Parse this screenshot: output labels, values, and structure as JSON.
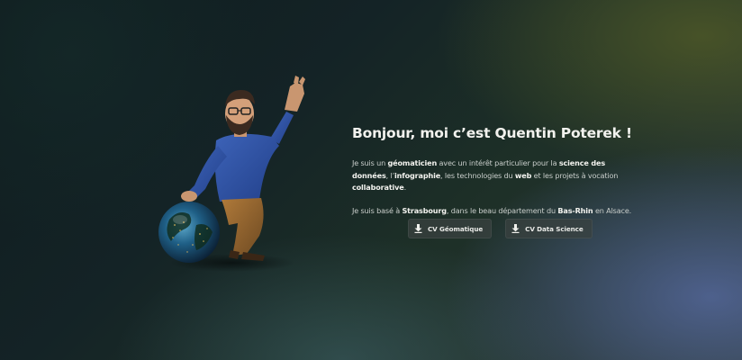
{
  "intro": {
    "headline": "Bonjour, moi c’est Quentin Poterek !",
    "p1": {
      "t1": "Je suis un ",
      "b1": "géomaticien",
      "t2": " avec un intérêt particulier pour la ",
      "b2": "science des données",
      "t3": ", l’",
      "b3": "infographie",
      "t4": ", les technologies du ",
      "b4": "web",
      "t5": " et les projets à vocation ",
      "b5": "collaborative",
      "t6": "."
    },
    "p2": {
      "t1": "Je suis basé à ",
      "b1": "Strasbourg",
      "t2": ", dans le beau département du ",
      "b2": "Bas-Rhin",
      "t3": " en Alsace."
    }
  },
  "buttons": {
    "cv_geomatique": "CV Géomatique",
    "cv_data_science": "CV Data Science"
  },
  "icons": {
    "download": "download-arrow-icon"
  },
  "colors": {
    "headline": "#f2f2ee",
    "body_text": "#c9cecb",
    "button_bg": "#3a4240"
  }
}
